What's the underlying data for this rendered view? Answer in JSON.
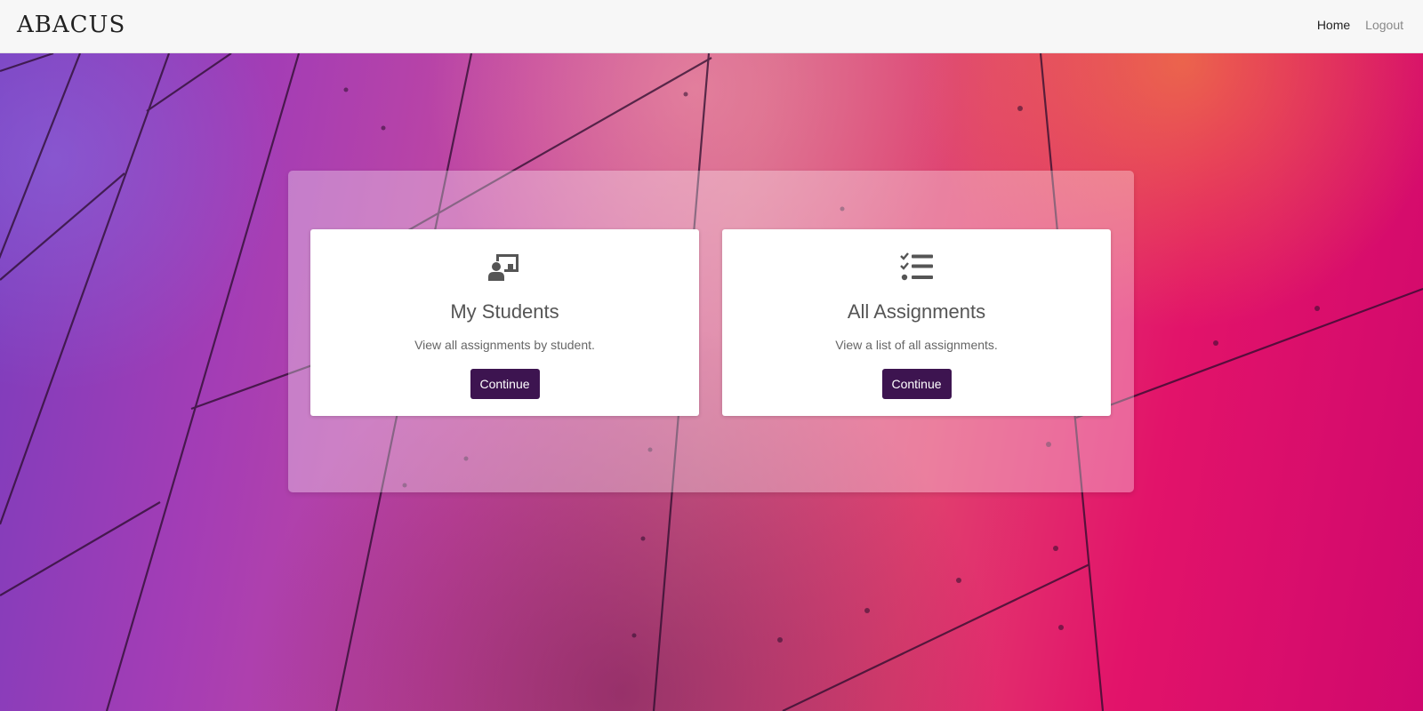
{
  "navbar": {
    "brand": "ABACUS",
    "links": [
      {
        "label": "Home"
      },
      {
        "label": "Logout"
      }
    ]
  },
  "cards": [
    {
      "icon": "chalkboard-user-icon",
      "title": "My Students",
      "description": "View all assignments by student.",
      "button_label": "Continue"
    },
    {
      "icon": "list-check-icon",
      "title": "All Assignments",
      "description": "View a list of all assignments.",
      "button_label": "Continue"
    }
  ],
  "colors": {
    "button": "#3d1450",
    "navbar": "#f7f7f7",
    "icon": "#555555"
  }
}
